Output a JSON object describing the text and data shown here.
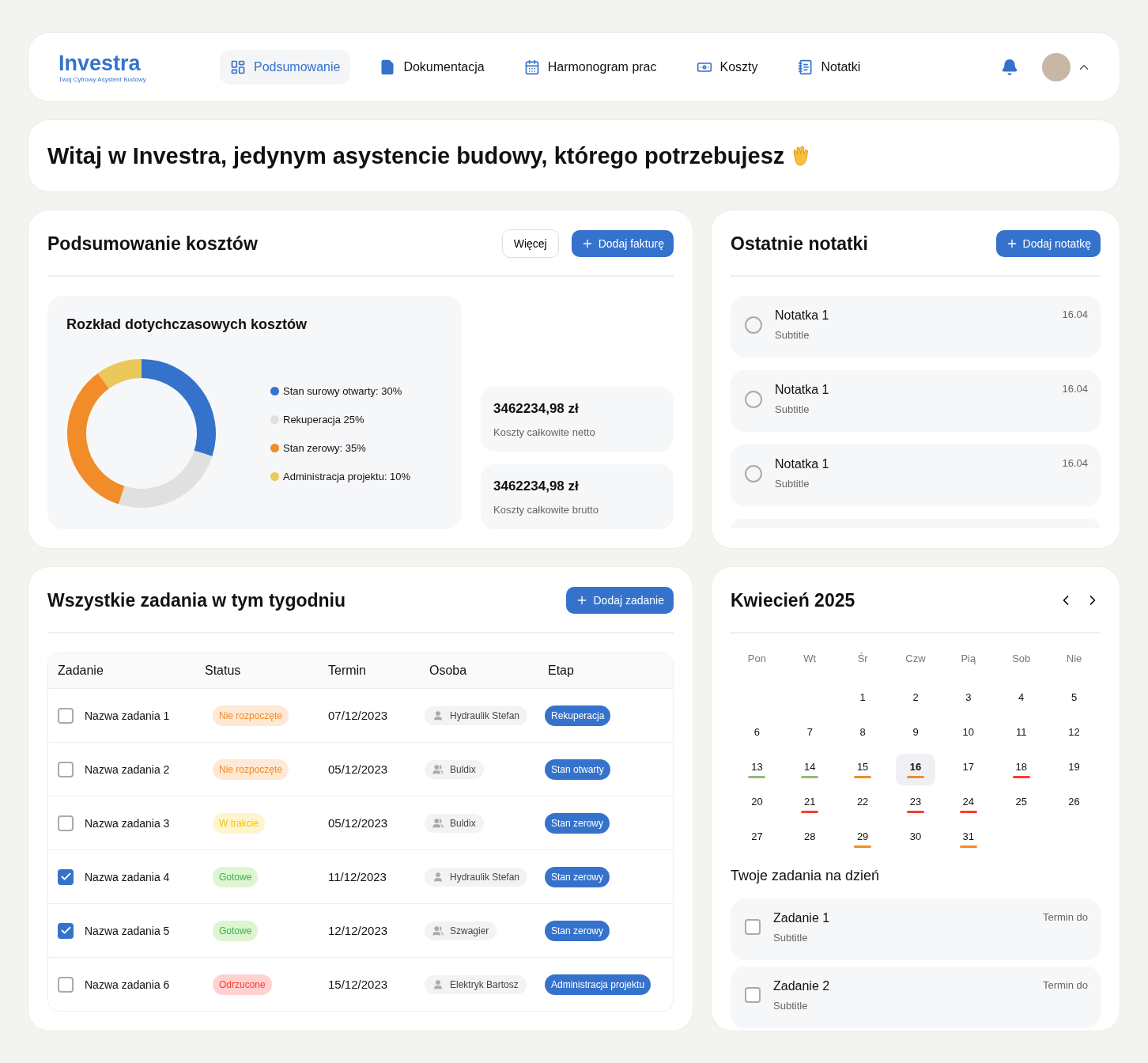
{
  "brand": {
    "name": "Investra",
    "tagline": "Twój Cyfrowy Asystent Budowy"
  },
  "nav": [
    {
      "label": "Podsumowanie",
      "kind": "dashboard",
      "selected": true
    },
    {
      "label": "Dokumentacja",
      "kind": "document",
      "selected": false
    },
    {
      "label": "Harmonogram prac",
      "kind": "calendar",
      "selected": false
    },
    {
      "label": "Koszty",
      "kind": "money",
      "selected": false
    },
    {
      "label": "Notatki",
      "kind": "notes",
      "selected": false
    }
  ],
  "welcome": "Witaj w Investra, jedynym asystencie budowy, którego potrzebujesz",
  "costs": {
    "title": "Podsumowanie kosztów",
    "more_button": "Więcej",
    "add_button": "Dodaj fakturę",
    "chart_data": {
      "type": "donut",
      "title": "Rozkład dotychczasowych kosztów",
      "categories": [
        "Stan surowy otwarty: 30%",
        "Rekuperacja 25%",
        "Stan zerowy: 35%",
        "Administracja projektu: 10%"
      ],
      "values": [
        30,
        25,
        35,
        10
      ],
      "colors": [
        "#3572cc",
        "#e0e0e0",
        "#f28c28",
        "#ebc85a"
      ]
    },
    "totals": [
      {
        "amount": "3462234,98 zł",
        "label": "Koszty całkowite netto"
      },
      {
        "amount": "3462234,98 zł",
        "label": "Koszty całkowite brutto"
      }
    ]
  },
  "notes": {
    "title": "Ostatnie notatki",
    "add_button": "Dodaj notatkę",
    "items": [
      {
        "title": "Notatka 1",
        "subtitle": "Subtitle",
        "date": "16.04",
        "checked": false
      },
      {
        "title": "Notatka 1",
        "subtitle": "Subtitle",
        "date": "16.04",
        "checked": false
      },
      {
        "title": "Notatka 1",
        "subtitle": "Subtitle",
        "date": "16.04",
        "checked": false
      }
    ]
  },
  "tasks": {
    "title": "Wszystkie zadania w tym tygodniu",
    "add_button": "Dodaj zadanie",
    "columns": [
      "Zadanie",
      "Status",
      "Termin",
      "Osoba",
      "Etap"
    ],
    "rows": [
      {
        "name": "Nazwa zadania 1",
        "checked": false,
        "status": {
          "text": "Nie rozpoczęte",
          "kind": "not_started"
        },
        "due": "07/12/2023",
        "person": {
          "text": "Hydraulik Stefan",
          "kind": "single"
        },
        "stage": "Rekuperacja"
      },
      {
        "name": "Nazwa zadania 2",
        "checked": false,
        "status": {
          "text": "Nie rozpoczęte",
          "kind": "not_started"
        },
        "due": "05/12/2023",
        "person": {
          "text": "Buldix",
          "kind": "group"
        },
        "stage": "Stan otwarty"
      },
      {
        "name": "Nazwa zadania 3",
        "checked": false,
        "status": {
          "text": "W trakcie",
          "kind": "in_progress"
        },
        "due": "05/12/2023",
        "person": {
          "text": "Buldix",
          "kind": "group"
        },
        "stage": "Stan zerowy"
      },
      {
        "name": "Nazwa zadania 4",
        "checked": true,
        "status": {
          "text": "Gotowe",
          "kind": "done"
        },
        "due": "11/12/2023",
        "person": {
          "text": "Hydraulik Stefan",
          "kind": "single"
        },
        "stage": "Stan zerowy"
      },
      {
        "name": "Nazwa zadania 5",
        "checked": true,
        "status": {
          "text": "Gotowe",
          "kind": "done"
        },
        "due": "12/12/2023",
        "person": {
          "text": "Szwagier",
          "kind": "group"
        },
        "stage": "Stan zerowy"
      },
      {
        "name": "Nazwa zadania 6",
        "checked": false,
        "status": {
          "text": "Odrzucone",
          "kind": "rejected"
        },
        "due": "15/12/2023",
        "person": {
          "text": "Elektryk Bartosz",
          "kind": "single"
        },
        "stage": "Administracja projektu"
      }
    ]
  },
  "calendar": {
    "title": "Kwiecień 2025",
    "weekdays": [
      "Pon",
      "Wt",
      "Śr",
      "Czw",
      "Pią",
      "Sob",
      "Nie"
    ],
    "weeks": [
      {
        "days": [
          {
            "day": "1",
            "selected": false
          },
          {
            "day": "2",
            "selected": false
          },
          {
            "day": "3",
            "selected": false
          },
          {
            "day": "4",
            "selected": false
          },
          {
            "day": "5",
            "selected": false
          }
        ]
      },
      {
        "days": [
          {
            "day": "6",
            "selected": false
          },
          {
            "day": "7",
            "selected": false
          },
          {
            "day": "8",
            "selected": false
          },
          {
            "day": "9",
            "selected": false
          },
          {
            "day": "10",
            "selected": false
          },
          {
            "day": "11",
            "selected": false
          },
          {
            "day": "12",
            "selected": false
          }
        ]
      },
      {
        "days": [
          {
            "day": "13",
            "selected": false,
            "color": "#9cb87a"
          },
          {
            "day": "14",
            "selected": false,
            "color": "#9cb87a"
          },
          {
            "day": "15",
            "selected": false,
            "color": "#f28c28"
          },
          {
            "day": "16",
            "selected": true,
            "color": "#f28c28"
          },
          {
            "day": "17",
            "selected": false
          },
          {
            "day": "18",
            "selected": false,
            "color": "#ff3b30"
          },
          {
            "day": "19",
            "selected": false
          }
        ]
      },
      {
        "days": [
          {
            "day": "20",
            "selected": false
          },
          {
            "day": "21",
            "selected": false,
            "color": "#ff3b30"
          },
          {
            "day": "22",
            "selected": false
          },
          {
            "day": "23",
            "selected": false,
            "color": "#ff3b30"
          },
          {
            "day": "24",
            "selected": false,
            "color": "#ff3b30"
          },
          {
            "day": "25",
            "selected": false
          },
          {
            "day": "26",
            "selected": false
          }
        ]
      },
      {
        "days": [
          {
            "day": "27",
            "selected": false
          },
          {
            "day": "28",
            "selected": false
          },
          {
            "day": "29",
            "selected": false,
            "color": "#f28c28"
          },
          {
            "day": "30",
            "selected": false
          },
          {
            "day": "31",
            "selected": false,
            "color": "#f28c28"
          }
        ]
      }
    ],
    "day_tasks_title": "Twoje zadania na dzień",
    "day_tasks": [
      {
        "title": "Zadanie 1",
        "subtitle": "Subtitle",
        "due": "Termin do",
        "checked": false
      },
      {
        "title": "Zadanie 2",
        "subtitle": "Subtitle",
        "due": "Termin do",
        "checked": false
      }
    ]
  }
}
